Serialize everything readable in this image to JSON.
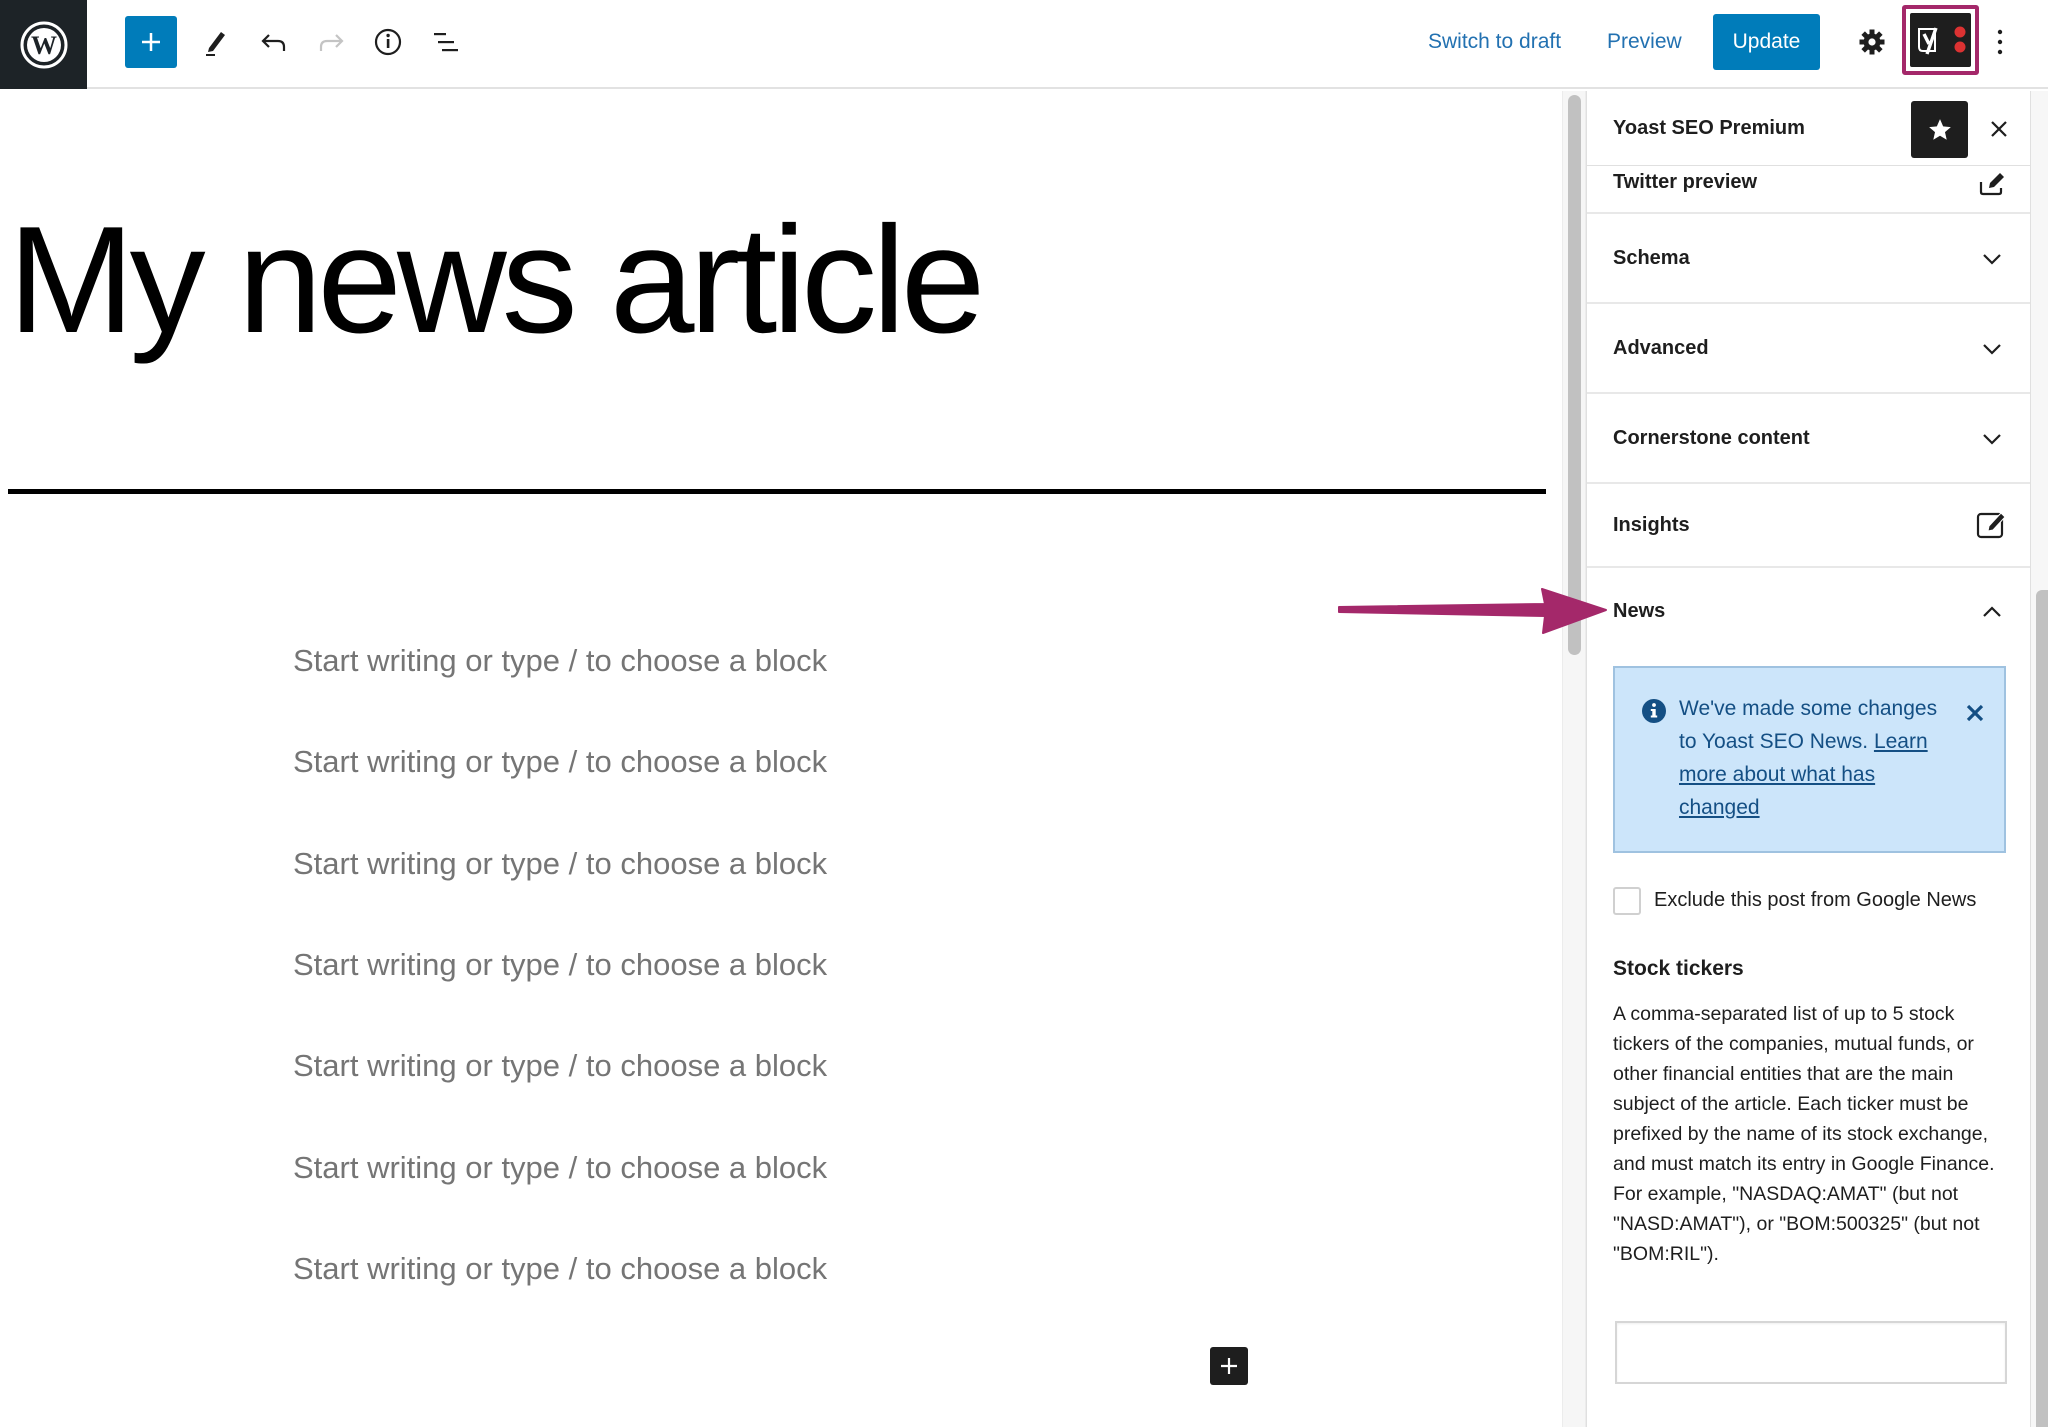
{
  "toolbar": {
    "logo": "wordpress-logo",
    "icons": {
      "add": "plus-icon",
      "tools": "pencil-icon",
      "undo": "undo-icon",
      "redo": "redo-icon",
      "details": "info-icon",
      "outline": "list-view-icon",
      "settings": "gear-icon",
      "yoast": "yoast-icon",
      "more": "more-vertical-icon"
    },
    "switch_to_draft": "Switch to draft",
    "preview": "Preview",
    "update": "Update"
  },
  "editor": {
    "title": "My news article",
    "placeholders": [
      "Start writing or type / to choose a block",
      "Start writing or type / to choose a block",
      "Start writing or type / to choose a block",
      "Start writing or type / to choose a block",
      "Start writing or type / to choose a block",
      "Start writing or type / to choose a block",
      "Start writing or type / to choose a block"
    ]
  },
  "sidebar": {
    "title": "Yoast SEO Premium",
    "panels": [
      {
        "label": "Twitter preview",
        "icon": "edit-icon"
      },
      {
        "label": "Schema",
        "icon": "chevron-down-icon"
      },
      {
        "label": "Advanced",
        "icon": "chevron-down-icon"
      },
      {
        "label": "Cornerstone content",
        "icon": "chevron-down-icon"
      },
      {
        "label": "Insights",
        "icon": "edit-icon"
      },
      {
        "label": "News",
        "icon": "chevron-up-icon",
        "expanded": true
      }
    ],
    "news": {
      "notice": {
        "text": "We've made some changes to Yoast SEO News. ",
        "link": "Learn more about what has changed"
      },
      "exclude_checkbox": {
        "label": "Exclude this post from Google News",
        "checked": false
      },
      "stock_tickers": {
        "heading": "Stock tickers",
        "description": "A comma-separated list of up to 5 stock tickers of the companies, mutual funds, or other financial entities that are the main subject of the article. Each ticker must be prefixed by the name of its stock exchange, and must match its entry in Google Finance. For example, \"NASDAQ:AMAT\" (but not \"NASD:AMAT\"), or \"BOM:500325\" (but not \"BOM:RIL\").",
        "value": ""
      }
    }
  },
  "colors": {
    "accent": "#007cba",
    "annotation": "#a4286a",
    "notice_bg": "#cce5fa",
    "notice_text": "#144f84"
  }
}
